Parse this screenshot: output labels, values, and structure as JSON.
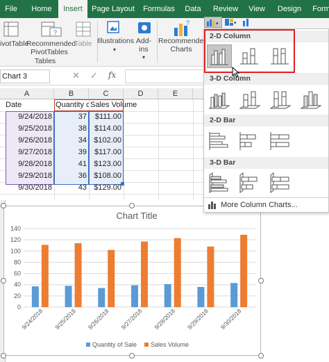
{
  "ribbon_tabs": [
    {
      "label": "File"
    },
    {
      "label": "Home"
    },
    {
      "label": "Insert"
    },
    {
      "label": "Page Layout"
    },
    {
      "label": "Formulas"
    },
    {
      "label": "Data"
    },
    {
      "label": "Review"
    },
    {
      "label": "View"
    },
    {
      "label": "Design"
    },
    {
      "label": "Form"
    }
  ],
  "ribbon": {
    "pivot_label": "ivotTable",
    "rec_pivot_label_1": "Recommended",
    "rec_pivot_label_2": "PivotTables",
    "table_label": "Table",
    "tables_group": "Tables",
    "illustrations_label": "Illustrations",
    "addins_label_1": "Add-",
    "addins_label_2": "ins",
    "rec_charts_label_1": "Recommended",
    "rec_charts_label_2": "Charts"
  },
  "formula_bar": {
    "name_box": "Chart 3",
    "cancel": "✕",
    "enter": "✓",
    "fx": "fx"
  },
  "grid": {
    "columns": [
      "A",
      "B",
      "C",
      "D",
      "E"
    ],
    "headers": [
      "Date",
      "Quantity c",
      "Sales Volume"
    ],
    "rows": [
      {
        "date": "9/24/2018",
        "qty": "37",
        "sales": "$111.00"
      },
      {
        "date": "9/25/2018",
        "qty": "38",
        "sales": "$114.00"
      },
      {
        "date": "9/26/2018",
        "qty": "34",
        "sales": "$102.00"
      },
      {
        "date": "9/27/2018",
        "qty": "39",
        "sales": "$117.00"
      },
      {
        "date": "9/28/2018",
        "qty": "41",
        "sales": "$123.00"
      },
      {
        "date": "9/29/2018",
        "qty": "36",
        "sales": "$108.00"
      },
      {
        "date": "9/30/2018",
        "qty": "43",
        "sales": "$129.00"
      }
    ]
  },
  "chart_data": {
    "type": "bar",
    "title": "Chart Title",
    "categories": [
      "9/24/2018",
      "9/25/2018",
      "9/26/2018",
      "9/27/2018",
      "9/28/2018",
      "9/29/2018",
      "9/30/2018"
    ],
    "series": [
      {
        "name": "Quantity of Sale",
        "values": [
          37,
          38,
          34,
          39,
          41,
          36,
          43
        ],
        "color": "#5b9bd5"
      },
      {
        "name": "Sales Volume",
        "values": [
          111,
          114,
          102,
          117,
          123,
          108,
          129
        ],
        "color": "#ed7d31"
      }
    ],
    "ylim": [
      0,
      140
    ],
    "yticks": [
      "0",
      "20",
      "40",
      "60",
      "80",
      "100",
      "120",
      "140"
    ],
    "grid": true,
    "legend": "bottom"
  },
  "dropdown": {
    "sections": [
      {
        "label": "2-D Column"
      },
      {
        "label": "3-D Column"
      },
      {
        "label": "2-D Bar"
      },
      {
        "label": "3-D Bar"
      }
    ],
    "more_label": "More Column Charts...",
    "highlight_color": "#e02020"
  }
}
